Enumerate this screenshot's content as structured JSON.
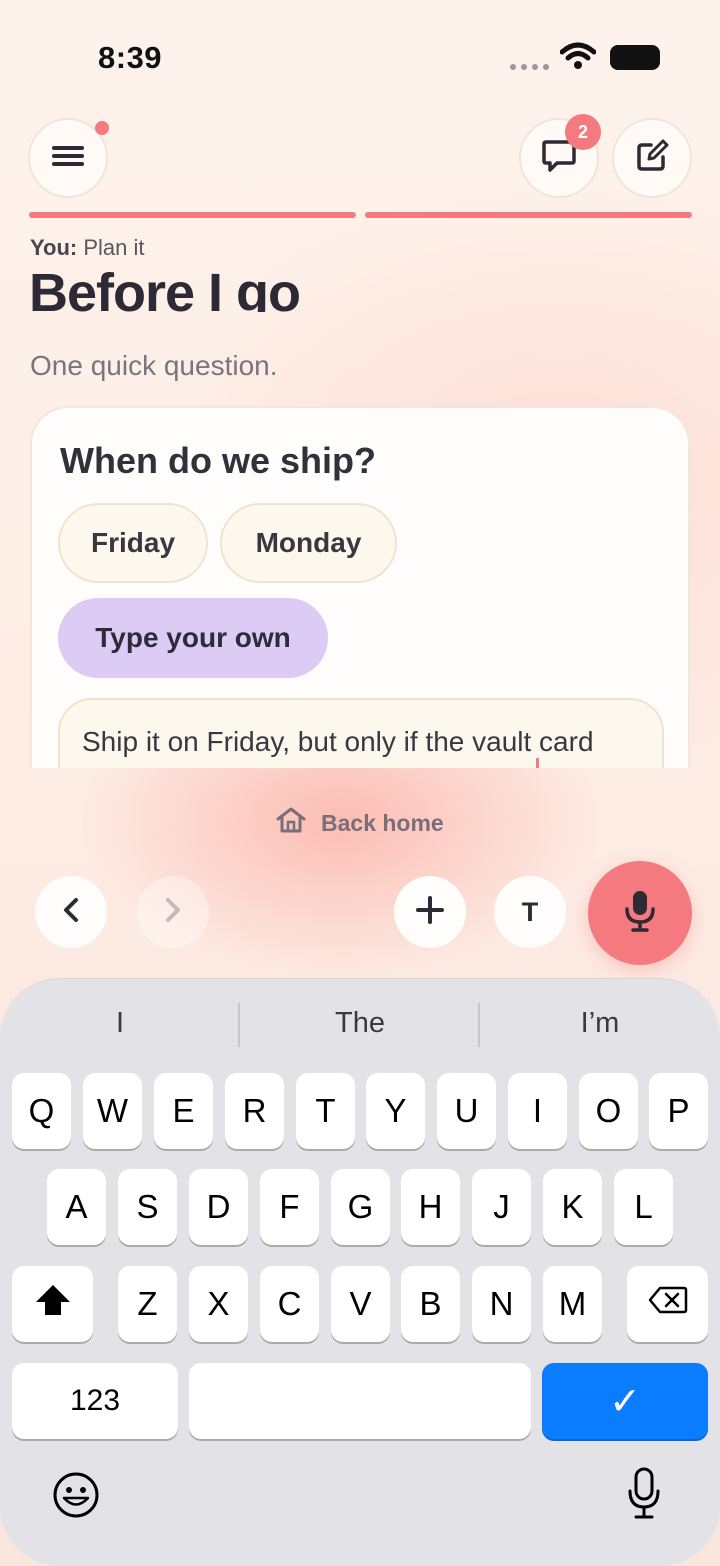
{
  "status": {
    "time": "8:39"
  },
  "header": {
    "chat_badge": "2"
  },
  "context": {
    "you_label": "You:",
    "you_value": "Plan it"
  },
  "page": {
    "title": "Before I go",
    "subtitle": "One quick question."
  },
  "question": {
    "text": "When do we ship?",
    "options": [
      "Friday",
      "Monday"
    ],
    "custom_option": "Type your own",
    "answer_value": "Ship it on Friday, but only if the vault card"
  },
  "nav": {
    "back_home": "Back home",
    "text_button": "T"
  },
  "keyboard": {
    "suggestions": [
      "I",
      "The",
      "I’m"
    ],
    "row1": [
      "Q",
      "W",
      "E",
      "R",
      "T",
      "Y",
      "U",
      "I",
      "O",
      "P"
    ],
    "row2": [
      "A",
      "S",
      "D",
      "F",
      "G",
      "H",
      "J",
      "K",
      "L"
    ],
    "row3": [
      "Z",
      "X",
      "C",
      "V",
      "B",
      "N",
      "M"
    ],
    "numbers_key": "123",
    "done_key": "✓"
  },
  "colors": {
    "accent": "#f47a7f",
    "custom_chip": "#dcccf5",
    "done_key": "#0a7cff"
  }
}
